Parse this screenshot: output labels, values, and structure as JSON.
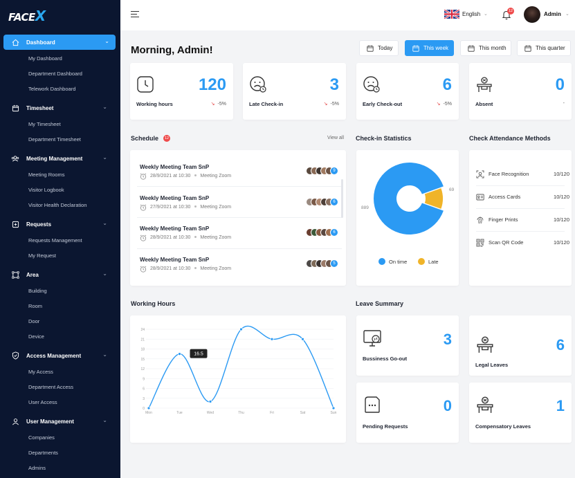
{
  "brand": {
    "logo_text": "FACE",
    "logo_x": "X"
  },
  "sidebar": {
    "groups": [
      {
        "label": "Dashboard",
        "icon": "home-icon",
        "items": [
          "My Dashboard",
          "Department Dashboard",
          "Telework Dashboard"
        ]
      },
      {
        "label": "Timesheet",
        "icon": "calendar-icon",
        "items": [
          "My Timesheet",
          "Department Timesheet"
        ]
      },
      {
        "label": "Meeting Management",
        "icon": "users-icon",
        "items": [
          "Meeting Rooms",
          "Visitor Logbook",
          "Visitor Health Declaration"
        ]
      },
      {
        "label": "Requests",
        "icon": "request-icon",
        "items": [
          "Requests Management",
          "My Request"
        ]
      },
      {
        "label": "Area",
        "icon": "area-icon",
        "items": [
          "Building",
          "Room",
          "Door",
          "Device"
        ]
      },
      {
        "label": "Access Management",
        "icon": "shield-icon",
        "items": [
          "My Access",
          "Department Access",
          "User Access"
        ]
      },
      {
        "label": "User Management",
        "icon": "user-icon",
        "items": [
          "Companies",
          "Departments",
          "Admins"
        ]
      }
    ]
  },
  "topbar": {
    "language": "English",
    "notifications": "12",
    "user_name": "Admin"
  },
  "greeting": "Morning, Admin!",
  "periods": [
    "Today",
    "This week",
    "This month",
    "This quarter"
  ],
  "active_period": "This week",
  "stats": [
    {
      "label": "Working hours",
      "value": "120",
      "trend": "-5%",
      "icon": "clock-icon"
    },
    {
      "label": "Late Check-in",
      "value": "3",
      "trend": "-5%",
      "icon": "sad-face-clock-icon"
    },
    {
      "label": "Early Check-out",
      "value": "6",
      "trend": "-5%",
      "icon": "sad-face-clock-icon"
    },
    {
      "label": "Absent",
      "value": "0",
      "trend": "-",
      "icon": "empty-desk-icon"
    }
  ],
  "schedule": {
    "title": "Schedule",
    "badge": "12",
    "view_all": "View all",
    "items": [
      {
        "title": "Weekly Meeting Team SnP",
        "date": "28/9/2021 at 10:30",
        "location": "Meeting Zoom",
        "more": "9"
      },
      {
        "title": "Weekly Meeting Team SnP",
        "date": "27/9/2021 at 10:30",
        "location": "Meeting Zoom",
        "more": "6"
      },
      {
        "title": "Weekly Meeting Team SnP",
        "date": "28/9/2021 at 10:30",
        "location": "Meeting Zoom",
        "more": "6"
      },
      {
        "title": "Weekly Meeting Team SnP",
        "date": "28/9/2021 at 10:30",
        "location": "Meeting Zoom",
        "more": "5"
      }
    ]
  },
  "checkin_stats": {
    "title": "Check-in Statistics"
  },
  "methods": {
    "title": "Check Attendance Methods",
    "items": [
      {
        "label": "Face Recognition",
        "value": "10/120",
        "icon": "face-scan-icon"
      },
      {
        "label": "Access Cards",
        "value": "10/120",
        "icon": "card-icon"
      },
      {
        "label": "Finger Prints",
        "value": "10/120",
        "icon": "fingerprint-icon"
      },
      {
        "label": "Scan QR Code",
        "value": "10/120",
        "icon": "qr-code-icon"
      }
    ]
  },
  "working_hours": {
    "title": "Working Hours",
    "tooltip": "16.5"
  },
  "leave": {
    "title": "Leave Summary",
    "items": [
      {
        "label": "Bussiness Go-out",
        "value": "3",
        "icon": "monitor-icon"
      },
      {
        "label": "Legal Leaves",
        "value": "6",
        "icon": "empty-desk-icon"
      },
      {
        "label": "Pending Requests",
        "value": "0",
        "icon": "document-icon"
      },
      {
        "label": "Compensatory Leaves",
        "value": "1",
        "icon": "empty-desk-icon"
      }
    ]
  },
  "colors": {
    "accent": "#2b9af3",
    "late": "#f0b429",
    "danger": "#ef4b4b",
    "sidebar": "#0b1630"
  },
  "chart_data": [
    {
      "type": "pie",
      "title": "Check-in Statistics",
      "categories": [
        "On time",
        "Late"
      ],
      "values": [
        889,
        69
      ],
      "colors": [
        "#2b9af3",
        "#f0b429"
      ],
      "donut": true,
      "legend": "bottom"
    },
    {
      "type": "line",
      "title": "Working Hours",
      "categories": [
        "Mon",
        "Tue",
        "Wed",
        "Thu",
        "Fri",
        "Sat",
        "Sun"
      ],
      "series": [
        {
          "values": [
            0,
            16.5,
            2,
            24,
            21,
            21,
            0
          ]
        }
      ],
      "y_ticks": [
        0,
        3,
        6,
        9,
        12,
        15,
        18,
        21,
        24
      ],
      "ylim": [
        0,
        24
      ],
      "grid": true
    }
  ]
}
